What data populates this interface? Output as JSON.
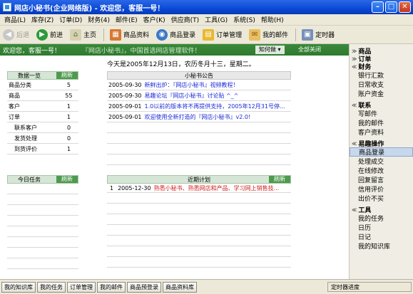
{
  "window": {
    "title": "网店小秘书(企业网络版) - 欢迎您，客服一号！"
  },
  "menu": [
    "商品(L)",
    "库存(Z)",
    "订单(D)",
    "财务(4)",
    "邮件(E)",
    "客户(K)",
    "供应商(T)",
    "工具(G)",
    "系统(S)",
    "帮助(H)"
  ],
  "toolbar": {
    "back": "后退",
    "forward": "前进",
    "home": "主页",
    "product_info": "商品资料",
    "product_login": "商品登录",
    "order_mgmt": "订单管理",
    "my_mail": "我的邮件",
    "timer": "定时器"
  },
  "welcome": {
    "text": "欢迎您，客服一号！",
    "banner": "『网店小秘书』，中国首选网店管理软件！",
    "dropdown": "知何做 ▾",
    "close_all": "全部关闭"
  },
  "date_text": "今天是2005年12月13日，农历冬月十三，星期二。",
  "stats": {
    "title": "数据一览",
    "refresh": "刷新",
    "rows": [
      {
        "label": "商品分类",
        "value": "5"
      },
      {
        "label": "商品",
        "value": "55"
      },
      {
        "label": "客户",
        "value": "1"
      },
      {
        "label": "订单",
        "value": "1"
      },
      {
        "label": "联系客户",
        "value": "0"
      },
      {
        "label": "发货处理",
        "value": "0"
      },
      {
        "label": "到货评价",
        "value": "1"
      }
    ]
  },
  "announcements": {
    "title": "小秘书公告",
    "rows": [
      {
        "date": "2005-09-30",
        "text": "新鲜出炉：『网店小秘书』视频教程！"
      },
      {
        "date": "2005-09-30",
        "text": "易趣论坛『网店小秘书』讨论贴 ^_^"
      },
      {
        "date": "2005-09-01",
        "text": "1.0以前的版本将不再提供支持，2005年12月31号停..."
      },
      {
        "date": "2005-09-01",
        "text": "欢迎使用全新打造的『网店小秘书』v2.0!"
      }
    ]
  },
  "tasks": {
    "title": "今日任务",
    "refresh": "刷新"
  },
  "plans": {
    "title": "近期计划",
    "refresh": "刷新",
    "rows": [
      {
        "num": "1",
        "date": "2005-12-30",
        "text": "熟悉小秘书、熟悉网店和产品、学习网上销售技..."
      }
    ]
  },
  "sidebar": {
    "groups": [
      {
        "label": "商品",
        "items": []
      },
      {
        "label": "订单",
        "items": []
      },
      {
        "label": "财务",
        "items": [
          "银行汇款",
          "日常收支",
          "账户资金"
        ]
      },
      {
        "label": "联系",
        "items": [
          "写邮件",
          "我的邮件",
          "客户资料"
        ]
      },
      {
        "label": "易趣操作",
        "items": [
          "商品登录",
          "处理成交",
          "在线修改",
          "回复留言",
          "信用评价",
          "出价不买"
        ]
      },
      {
        "label": "工具",
        "items": [
          "我的任务",
          "日历",
          "日记",
          "我的知识库"
        ]
      }
    ],
    "selected": "商品登录"
  },
  "taskbar": {
    "buttons": [
      "我的知识库",
      "我的任务",
      "订单管理",
      "我的邮件",
      "商品预登录",
      "商品资料库"
    ],
    "status": "定时器进度"
  },
  "colors": {
    "title_blue": "#0a4ad6",
    "green_header": "#3a8a3a",
    "link_blue": "#1b2ad8",
    "plan_red": "#d42020"
  }
}
